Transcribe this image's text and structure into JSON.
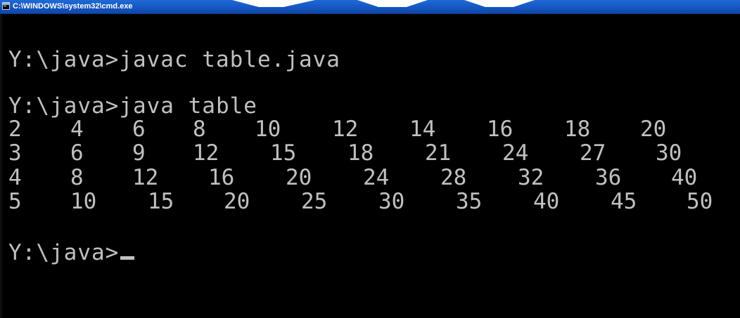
{
  "window": {
    "title": "C:\\WINDOWS\\system32\\cmd.exe",
    "icon": "console-icon",
    "colors": {
      "titlebar": "#1656c2",
      "console_background": "#000000",
      "console_text": "#c0c0c0"
    }
  },
  "console": {
    "commands": [
      {
        "prompt": "Y:\\java>",
        "command": "javac table.java"
      },
      {
        "prompt": "Y:\\java>",
        "command": "java table"
      }
    ],
    "output_rows": [
      [
        "2",
        "4",
        "6",
        "8",
        "10",
        "12",
        "14",
        "16",
        "18",
        "20"
      ],
      [
        "3",
        "6",
        "9",
        "12",
        "15",
        "18",
        "21",
        "24",
        "27",
        "30"
      ],
      [
        "4",
        "8",
        "12",
        "16",
        "20",
        "24",
        "28",
        "32",
        "36",
        "40"
      ],
      [
        "5",
        "10",
        "15",
        "20",
        "25",
        "30",
        "35",
        "40",
        "45",
        "50"
      ]
    ],
    "current_prompt": "Y:\\java>"
  }
}
